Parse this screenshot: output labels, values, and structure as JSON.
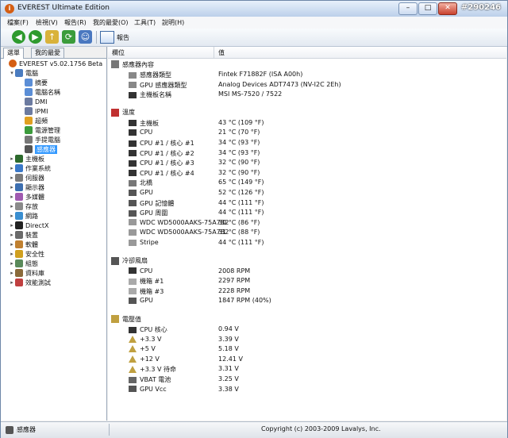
{
  "window": {
    "title": "EVEREST Ultimate Edition",
    "watermark": "#290246"
  },
  "menu": [
    "檔案(F)",
    "檢視(V)",
    "報告(R)",
    "我的最愛(O)",
    "工具(T)",
    "說明(H)"
  ],
  "toolbar": {
    "report_label": "報告"
  },
  "left_tabs": [
    "選單",
    "我的最愛"
  ],
  "tree": [
    {
      "label": "EVEREST v5.02.1756 Beta",
      "level": 0,
      "exp": "",
      "icon": "everest-icon",
      "color": "#d45e14"
    },
    {
      "label": "電腦",
      "level": 1,
      "exp": "▾",
      "icon": "computer-icon",
      "color": "#4a7cc0"
    },
    {
      "label": "摘要",
      "level": 2,
      "exp": "",
      "icon": "summary-icon",
      "color": "#5b8ed6"
    },
    {
      "label": "電腦名稱",
      "level": 2,
      "exp": "",
      "icon": "computer-name-icon",
      "color": "#5b8ed6"
    },
    {
      "label": "DMI",
      "level": 2,
      "exp": "",
      "icon": "dmi-icon",
      "color": "#6c7ba0"
    },
    {
      "label": "IPMI",
      "level": 2,
      "exp": "",
      "icon": "ipmi-icon",
      "color": "#6c7ba0"
    },
    {
      "label": "超頻",
      "level": 2,
      "exp": "",
      "icon": "overclock-icon",
      "color": "#e0a020"
    },
    {
      "label": "電源管理",
      "level": 2,
      "exp": "",
      "icon": "power-icon",
      "color": "#3c9b3c"
    },
    {
      "label": "手提電腦",
      "level": 2,
      "exp": "",
      "icon": "laptop-icon",
      "color": "#777"
    },
    {
      "label": "感應器",
      "level": 2,
      "exp": "",
      "icon": "sensor-icon",
      "color": "#555",
      "selected": true
    },
    {
      "label": "主機板",
      "level": 1,
      "exp": "▸",
      "icon": "motherboard-icon",
      "color": "#2d6a2d"
    },
    {
      "label": "作業系統",
      "level": 1,
      "exp": "▸",
      "icon": "os-icon",
      "color": "#3a78c8"
    },
    {
      "label": "伺服器",
      "level": 1,
      "exp": "▸",
      "icon": "server-icon",
      "color": "#7a7a7a"
    },
    {
      "label": "顯示器",
      "level": 1,
      "exp": "▸",
      "icon": "display-icon",
      "color": "#3d6fb0"
    },
    {
      "label": "多媒體",
      "level": 1,
      "exp": "▸",
      "icon": "multimedia-icon",
      "color": "#a05ab0"
    },
    {
      "label": "存放",
      "level": 1,
      "exp": "▸",
      "icon": "storage-icon",
      "color": "#8a8a8a"
    },
    {
      "label": "網路",
      "level": 1,
      "exp": "▸",
      "icon": "network-icon",
      "color": "#3a8ed0"
    },
    {
      "label": "DirectX",
      "level": 1,
      "exp": "▸",
      "icon": "directx-icon",
      "color": "#222"
    },
    {
      "label": "裝置",
      "level": 1,
      "exp": "▸",
      "icon": "devices-icon",
      "color": "#6a6a6a"
    },
    {
      "label": "軟體",
      "level": 1,
      "exp": "▸",
      "icon": "software-icon",
      "color": "#c08030"
    },
    {
      "label": "安全性",
      "level": 1,
      "exp": "▸",
      "icon": "security-icon",
      "color": "#d0a020"
    },
    {
      "label": "組態",
      "level": 1,
      "exp": "▸",
      "icon": "config-icon",
      "color": "#5a8a5a"
    },
    {
      "label": "資料庫",
      "level": 1,
      "exp": "▸",
      "icon": "database-icon",
      "color": "#8a6a3a"
    },
    {
      "label": "效能測試",
      "level": 1,
      "exp": "▸",
      "icon": "benchmark-icon",
      "color": "#c04040"
    }
  ],
  "columns": {
    "field": "欄位",
    "value": "值"
  },
  "sections": [
    {
      "title": "感應器內容",
      "icon": "sensor-props-icon",
      "color": "#777",
      "rows": [
        {
          "field": "感應器類型",
          "value": "Fintek F71882F  (ISA A00h)",
          "icon": "sensor-type-icon",
          "color": "#888"
        },
        {
          "field": "GPU 感應器類型",
          "value": "Analog Devices ADT7473  (NV-I2C 2Eh)",
          "icon": "gpu-sensor-icon",
          "color": "#888"
        },
        {
          "field": "主機板名稱",
          "value": "MSI MS-7520 / 7522",
          "icon": "mb-name-icon",
          "color": "#333"
        }
      ]
    },
    {
      "title": "溫度",
      "icon": "thermometer-icon",
      "color": "#c03030",
      "rows": [
        {
          "field": "主機板",
          "value": "43 °C  (109 °F)",
          "icon": "chip-icon",
          "color": "#333"
        },
        {
          "field": "CPU",
          "value": "21 °C  (70 °F)",
          "icon": "chip-icon",
          "color": "#333"
        },
        {
          "field": "CPU #1 / 核心 #1",
          "value": "34 °C  (93 °F)",
          "icon": "chip-icon",
          "color": "#333"
        },
        {
          "field": "CPU #1 / 核心 #2",
          "value": "34 °C  (93 °F)",
          "icon": "chip-icon",
          "color": "#333"
        },
        {
          "field": "CPU #1 / 核心 #3",
          "value": "32 °C  (90 °F)",
          "icon": "chip-icon",
          "color": "#333"
        },
        {
          "field": "CPU #1 / 核心 #4",
          "value": "32 °C  (90 °F)",
          "icon": "chip-icon",
          "color": "#333"
        },
        {
          "field": "北橋",
          "value": "65 °C  (149 °F)",
          "icon": "northbridge-icon",
          "color": "#777"
        },
        {
          "field": "GPU",
          "value": "52 °C  (126 °F)",
          "icon": "gpu-icon",
          "color": "#555"
        },
        {
          "field": "GPU 記憶體",
          "value": "44 °C  (111 °F)",
          "icon": "gpu-icon",
          "color": "#555"
        },
        {
          "field": "GPU 周圍",
          "value": "44 °C  (111 °F)",
          "icon": "gpu-icon",
          "color": "#555"
        },
        {
          "field": "WDC WD5000AAKS-75A7B2",
          "value": "30 °C  (86 °F)",
          "icon": "disk-icon",
          "color": "#999"
        },
        {
          "field": "WDC WD5000AAKS-75A7B2",
          "value": "31 °C  (88 °F)",
          "icon": "disk-icon",
          "color": "#999"
        },
        {
          "field": "Stripe",
          "value": "44 °C  (111 °F)",
          "icon": "disk-icon",
          "color": "#999"
        }
      ]
    },
    {
      "title": "冷卻風扇",
      "icon": "fan-icon",
      "color": "#555",
      "rows": [
        {
          "field": "CPU",
          "value": "2008 RPM",
          "icon": "chip-icon",
          "color": "#333"
        },
        {
          "field": "機箱 #1",
          "value": "2297 RPM",
          "icon": "case-icon",
          "color": "#aaa"
        },
        {
          "field": "機箱 #3",
          "value": "2228 RPM",
          "icon": "case-icon",
          "color": "#aaa"
        },
        {
          "field": "GPU",
          "value": "1847 RPM  (40%)",
          "icon": "gpu-icon",
          "color": "#555"
        }
      ]
    },
    {
      "title": "電壓值",
      "icon": "voltage-icon",
      "color": "#c0a040",
      "rows": [
        {
          "field": "CPU 核心",
          "value": "0.94 V",
          "icon": "chip-icon",
          "color": "#333"
        },
        {
          "field": "+3.3 V",
          "value": "3.39 V",
          "icon": "volt-triangle-icon",
          "color": "#c0a040"
        },
        {
          "field": "+5 V",
          "value": "5.18 V",
          "icon": "volt-triangle-icon",
          "color": "#c0a040"
        },
        {
          "field": "+12 V",
          "value": "12.41 V",
          "icon": "volt-triangle-icon",
          "color": "#c0a040"
        },
        {
          "field": "+3.3 V 待命",
          "value": "3.31 V",
          "icon": "volt-triangle-icon",
          "color": "#c0a040"
        },
        {
          "field": "VBAT 電池",
          "value": "3.25 V",
          "icon": "battery-icon",
          "color": "#666"
        },
        {
          "field": "GPU Vcc",
          "value": "3.38 V",
          "icon": "gpu-icon",
          "color": "#555"
        }
      ]
    }
  ],
  "status": {
    "left": "感應器",
    "right": "Copyright (c) 2003-2009 Lavalys, Inc."
  }
}
